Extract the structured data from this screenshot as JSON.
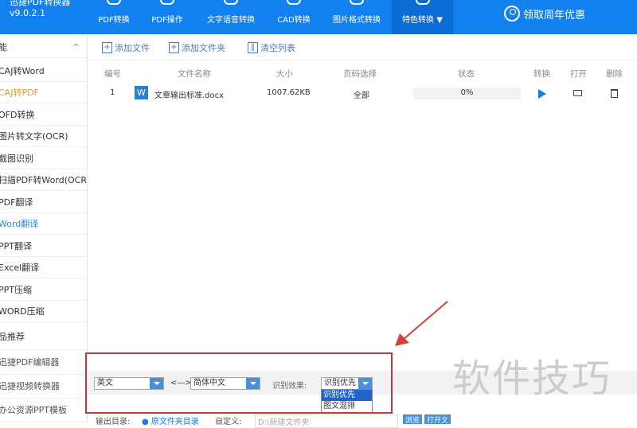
{
  "app": {
    "title": "迅捷PDF转换器",
    "version": "v9.0.2.1"
  },
  "nav": [
    {
      "label": "PDF转换"
    },
    {
      "label": "PDF操作"
    },
    {
      "label": "文字语音转换"
    },
    {
      "label": "CAD转换"
    },
    {
      "label": "图片格式转换"
    },
    {
      "label": "特色转换 ▼"
    }
  ],
  "promo": "领取周年优惠",
  "sidebar": {
    "header": "能",
    "items": [
      "CAJ转Word",
      "CAJ转PDF",
      "OFD转换",
      "图片转文字(OCR)",
      "截图识别",
      "扫描PDF转Word(OCR)",
      "PDF翻译",
      "Word翻译",
      "PPT翻译",
      "Excel翻译",
      "PPT压缩",
      "WORD压缩"
    ],
    "section": "品推荐",
    "products": [
      "迅捷PDF编辑器",
      "迅捷视频转换器",
      "办公资源PPT模板"
    ]
  },
  "toolbar": {
    "add_file": "添加文件",
    "add_folder": "添加文件夹",
    "clear": "清空列表"
  },
  "table": {
    "headers": [
      "编号",
      "文件名称",
      "大小",
      "页码选择",
      "状态",
      "转换",
      "打开",
      "删除"
    ],
    "rows": [
      {
        "num": "1",
        "name": "文章输出标准.docx",
        "size": "1007.62KB",
        "pages": "全部",
        "status": "0%",
        "progress": 0
      }
    ]
  },
  "translate": {
    "source": "英文",
    "arrow": "<—>",
    "target": "简体中文",
    "effect_label": "识别效果:",
    "effect": "识别优先",
    "options": [
      "识别优先",
      "图文混排"
    ]
  },
  "output": {
    "label": "输出目录:",
    "original": "原文件夹目录",
    "custom": "自定义:",
    "path": "D:\\新建文件夹",
    "browse": "浏览",
    "open": "打开文"
  },
  "watermark": "软件技巧",
  "colors": {
    "brand": "#1380f0",
    "highlight": "#c0393b"
  }
}
